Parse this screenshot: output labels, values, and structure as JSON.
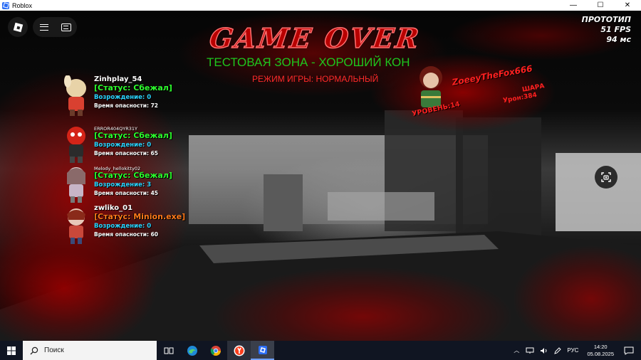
{
  "window": {
    "title": "Roblox",
    "minimize": "—",
    "maximize": "☐",
    "close": "✕"
  },
  "hud": {
    "prototype_label": "ПРОТОТИП",
    "fps": "51 FPS",
    "ping": "94 мс"
  },
  "game": {
    "title": "GAME OVER",
    "zone": "ТЕСТОВАЯ ЗОНА - ХОРОШИЙ КОН",
    "mode": "РЕЖИМ ИГРЫ: НОРМАЛЬНЫЙ"
  },
  "players": [
    {
      "name": "Zinhplay_54",
      "status": "[Статус: Сбежал]",
      "revive": "Возрождение: 0",
      "danger": "Время опасности: 72",
      "avatar_color": "#e8d3a8"
    },
    {
      "name": "ERROR404QYR31Y",
      "status": "[Статус: Сбежал]",
      "revive": "Возрождение: 0",
      "danger": "Время опасности: 65",
      "avatar_color": "#c8201a"
    },
    {
      "name": "Melody_hellokitty02",
      "status": "[Статус: Сбежал]",
      "revive": "Возрождение: 3",
      "danger": "Время опасности: 45",
      "avatar_color": "#d9c7c7"
    },
    {
      "name": "zwliko_01",
      "status": "[Статус: Minion.exe]",
      "revive": "Возрождение: 0",
      "danger": "Время опасности: 60",
      "avatar_color": "#c9483a"
    }
  ],
  "right_player": {
    "name": "ZoeeyTheFox666",
    "level": "УРОВЕНЬ:14",
    "class": "ШАРА",
    "level2": "Урон:384"
  },
  "taskbar": {
    "search_placeholder": "Поиск",
    "language": "РУС",
    "time": "14:20",
    "date": "05.08.2025"
  }
}
